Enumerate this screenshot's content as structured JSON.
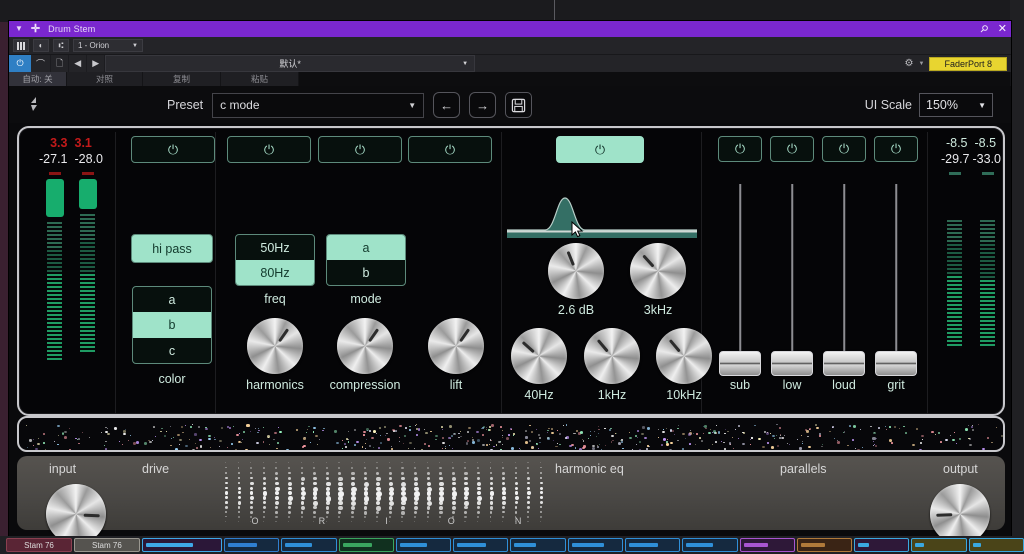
{
  "window": {
    "title": "Drum Stem",
    "accent_color": "#7a27cf",
    "pin_icon": "pin-icon",
    "close_icon": "close-icon"
  },
  "host_toolbar": {
    "icons": [
      "keyboard-icon",
      "phase-icon",
      "routing-icon"
    ],
    "channel_select": "1 - Orion",
    "power_icon": "power-icon",
    "headphone_icon": "headphone-icon",
    "file_icon": "file-icon",
    "prev_icon": "prev-icon",
    "next_icon": "next-icon",
    "preset_value": "默认*",
    "gear_icon": "gear-icon",
    "controller_badge": "FaderPort 8"
  },
  "host_toolbar_row2": {
    "automation": "自动: 关",
    "compare": "对照",
    "copy": "复制",
    "paste": "粘贴"
  },
  "preset_bar": {
    "label": "Preset",
    "value": "c mode",
    "prev_icon": "arrow-left-icon",
    "next_icon": "arrow-right-icon",
    "save_icon": "floppy-save-icon",
    "ui_scale_label": "UI Scale",
    "ui_scale_value": "150%"
  },
  "colors": {
    "mint": "#9fe3c9",
    "mint_text": "#cfeadf",
    "meter_green": "#17ad6d",
    "red": "#c21a1a",
    "badge_yellow": "#e8d530"
  },
  "input_meters": {
    "peak_left": "3.3",
    "peak_right": "3.1",
    "level_left": "-27.1",
    "level_right": "-28.0"
  },
  "output_meters": {
    "peak_left": "-8.5",
    "peak_right": "-8.5",
    "level_left": "-29.7",
    "level_right": "-33.0"
  },
  "drive_section": {
    "power_icon": "power-icon",
    "hi_pass": {
      "label": "hi pass",
      "active": true
    },
    "color": {
      "label": "color",
      "options": [
        "a",
        "b",
        "c"
      ],
      "selected": "b"
    }
  },
  "harmonics_section": {
    "power_icons": [
      "power-icon",
      "power-icon",
      "power-icon"
    ],
    "freq": {
      "label": "freq",
      "options": [
        "50Hz",
        "80Hz"
      ],
      "selected": "80Hz"
    },
    "mode": {
      "label": "mode",
      "options": [
        "a",
        "b"
      ],
      "selected": "a"
    },
    "knobs": [
      {
        "name": "harmonics",
        "label": "harmonics",
        "angle": 35
      },
      {
        "name": "compression",
        "label": "compression",
        "angle": 35
      },
      {
        "name": "lift",
        "label": "lift",
        "angle": 35
      }
    ]
  },
  "harmonic_eq": {
    "section_label": "harmonic eq",
    "power_icon": "power-icon",
    "power_on": true,
    "knobs": [
      {
        "name": "gain",
        "label": "2.6 dB",
        "angle": -22
      },
      {
        "name": "frequency",
        "label": "3kHz",
        "angle": -42
      },
      {
        "name": "band-40hz",
        "label": "40Hz",
        "angle": -48
      },
      {
        "name": "band-1khz",
        "label": "1kHz",
        "angle": -40
      },
      {
        "name": "band-10khz",
        "label": "10kHz",
        "angle": -40
      }
    ]
  },
  "parallels": {
    "section_label": "parallels",
    "faders": [
      {
        "name": "sub",
        "label": "sub",
        "power_icon": "power-icon",
        "value_pct": 0
      },
      {
        "name": "low",
        "label": "low",
        "power_icon": "power-icon",
        "value_pct": 0
      },
      {
        "name": "loud",
        "label": "loud",
        "power_icon": "power-icon",
        "value_pct": 0
      },
      {
        "name": "grit",
        "label": "grit",
        "power_icon": "power-icon",
        "value_pct": 0
      }
    ]
  },
  "bottom_panel": {
    "labels": [
      "input",
      "drive",
      "harmonic eq",
      "parallels",
      "output"
    ],
    "input_knob": {
      "name": "input",
      "angle": 92
    },
    "output_knob": {
      "name": "output",
      "angle": -92
    },
    "brand_letters": [
      "O",
      "R",
      "I",
      "O",
      "N"
    ]
  },
  "taskbar": {
    "chips": [
      "Stam 76",
      "Stam 76"
    ]
  }
}
